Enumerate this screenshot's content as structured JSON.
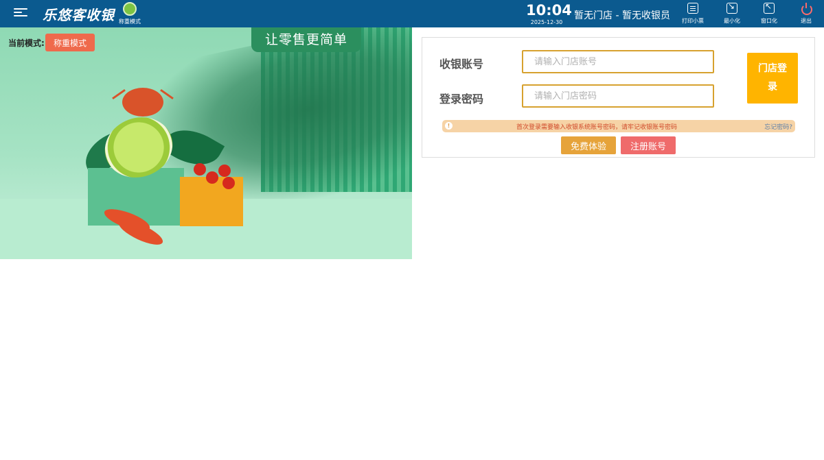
{
  "header": {
    "menu_icon": "menu-icon",
    "logo_text": "乐悠客收银",
    "mode_tile_label": "称重模式",
    "time": "10:04",
    "date": "2025-12-30",
    "store_info": "暂无门店 - 暂无收银员",
    "buttons": [
      {
        "label": "打印小票",
        "icon": "receipt-icon"
      },
      {
        "label": "最小化",
        "icon": "minimize-icon"
      },
      {
        "label": "窗口化",
        "icon": "window-icon"
      },
      {
        "label": "退出",
        "icon": "power-icon"
      }
    ],
    "colors": {
      "bar": "#0b5a8f",
      "exit": "#ff6b6b"
    }
  },
  "banner": {
    "slogan": "让零售更简单",
    "mode_label": "当前模式:",
    "mode_button": "称重模式"
  },
  "login": {
    "account_label": "收银账号",
    "account_placeholder": "请输入门店账号",
    "password_label": "登录密码",
    "password_placeholder": "请输入门店密码",
    "login_button": "门店登录",
    "notice_text": "首次登录需要输入收银系统账号密码，请牢记收银账号密码",
    "forgot_link": "忘记密码?",
    "free_trial_button": "免费体验",
    "register_button": "注册账号",
    "colors": {
      "login": "#ffb400",
      "input_border": "#d7a12e",
      "free": "#e6a33a",
      "register": "#ef6b6b"
    }
  }
}
